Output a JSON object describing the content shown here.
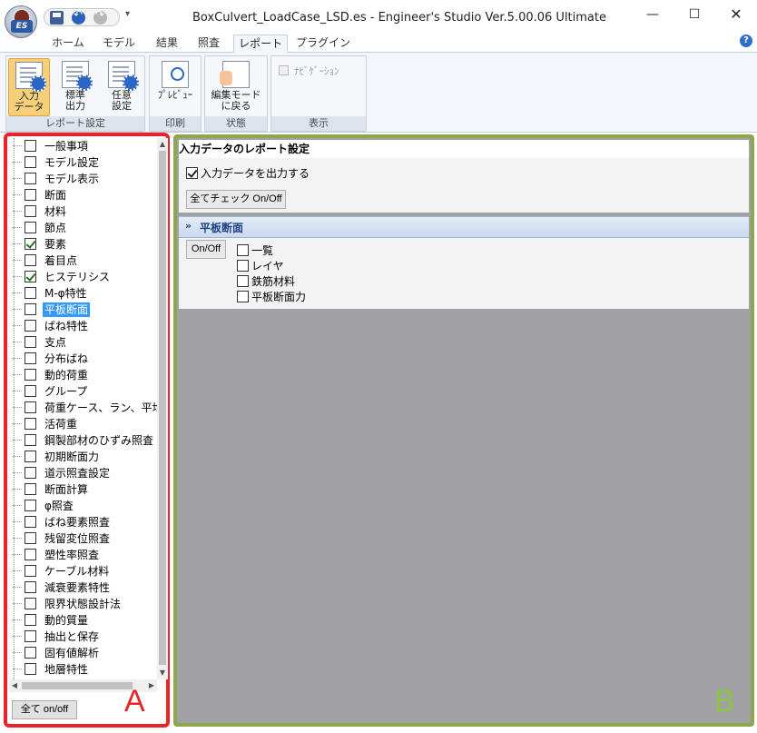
{
  "window": {
    "title": "BoxCulvert_LoadCase_LSD.es - Engineer's Studio Ver.5.00.06 Ultimate",
    "logo_text": "ES",
    "qat_more": "▾",
    "minimize": "—",
    "maximize": "☐",
    "close": "✕"
  },
  "ribbon_tabs": [
    {
      "label": "ホーム"
    },
    {
      "label": "モデル"
    },
    {
      "label": "結果"
    },
    {
      "label": "照査"
    },
    {
      "label": "レポート",
      "active": true
    },
    {
      "label": "プラグイン"
    }
  ],
  "help": "?",
  "ribbon": {
    "groups": [
      {
        "label": "レポート設定",
        "buttons": [
          {
            "line1": "入力",
            "line2": "データ",
            "icon": "report-input-icon",
            "active": true
          },
          {
            "line1": "標準",
            "line2": "出力",
            "icon": "standard-output-icon"
          },
          {
            "line1": "任意",
            "line2": "設定",
            "icon": "custom-setting-icon"
          }
        ]
      },
      {
        "label": "印刷",
        "buttons": [
          {
            "line1": "ﾌﾟﾚﾋﾞｭｰ",
            "line2": "",
            "icon": "preview-icon"
          }
        ]
      },
      {
        "label": "状態",
        "buttons": [
          {
            "line1": "編集モード",
            "line2": "に戻る",
            "icon": "edit-mode-icon"
          }
        ]
      },
      {
        "label": "表示",
        "navigation_label": "ﾅﾋﾞｹﾞｰｼｮﾝ",
        "navigation_checked": false
      }
    ]
  },
  "tree": {
    "items": [
      {
        "label": "一般事項",
        "checked": false
      },
      {
        "label": "モデル設定",
        "checked": false
      },
      {
        "label": "モデル表示",
        "checked": false
      },
      {
        "label": "断面",
        "checked": false
      },
      {
        "label": "材料",
        "checked": false
      },
      {
        "label": "節点",
        "checked": false
      },
      {
        "label": "要素",
        "checked": true
      },
      {
        "label": "着目点",
        "checked": false
      },
      {
        "label": "ヒステリシス",
        "checked": true
      },
      {
        "label": "M-φ特性",
        "checked": false
      },
      {
        "label": "平板断面",
        "checked": false,
        "selected": true
      },
      {
        "label": "ばね特性",
        "checked": false
      },
      {
        "label": "支点",
        "checked": false
      },
      {
        "label": "分布ばね",
        "checked": false
      },
      {
        "label": "動的荷重",
        "checked": false
      },
      {
        "label": "グループ",
        "checked": false
      },
      {
        "label": "荷重ケース、ラン、平均",
        "checked": false
      },
      {
        "label": "活荷重",
        "checked": false
      },
      {
        "label": "鋼製部材のひずみ照査",
        "checked": false
      },
      {
        "label": "初期断面力",
        "checked": false
      },
      {
        "label": "道示照査設定",
        "checked": false
      },
      {
        "label": "断面計算",
        "checked": false
      },
      {
        "label": "φ照査",
        "checked": false
      },
      {
        "label": "ばね要素照査",
        "checked": false
      },
      {
        "label": "残留変位照査",
        "checked": false
      },
      {
        "label": "塑性率照査",
        "checked": false
      },
      {
        "label": "ケーブル材料",
        "checked": false
      },
      {
        "label": "減衰要素特性",
        "checked": false
      },
      {
        "label": "限界状態設計法",
        "checked": false
      },
      {
        "label": "動的質量",
        "checked": false
      },
      {
        "label": "抽出と保存",
        "checked": false
      },
      {
        "label": "固有値解析",
        "checked": false
      },
      {
        "label": "地層特性",
        "checked": false
      }
    ],
    "all_toggle": "全て on/off",
    "scroll_up": "▲",
    "scroll_down": "▼",
    "scroll_left": "◀",
    "scroll_right": "▶"
  },
  "markers": {
    "a": "A",
    "b": "B"
  },
  "report": {
    "title": "入力データのレポート設定",
    "output_checkbox_label": "入力データを出力する",
    "output_checked": true,
    "all_check_button": "全てチェック On/Off",
    "section": {
      "chevron": "»",
      "title": "平板断面",
      "toggle_button": "On/Off",
      "options": [
        {
          "label": "一覧",
          "checked": false
        },
        {
          "label": "レイヤ",
          "checked": false
        },
        {
          "label": "鉄筋材料",
          "checked": false
        },
        {
          "label": "平板断面力",
          "checked": false
        }
      ]
    }
  },
  "colors": {
    "panel_a_border": "#e8242a",
    "panel_b_border": "#8ca84a",
    "selection": "#3399ff",
    "ribbon_active": "#f8cf79"
  }
}
